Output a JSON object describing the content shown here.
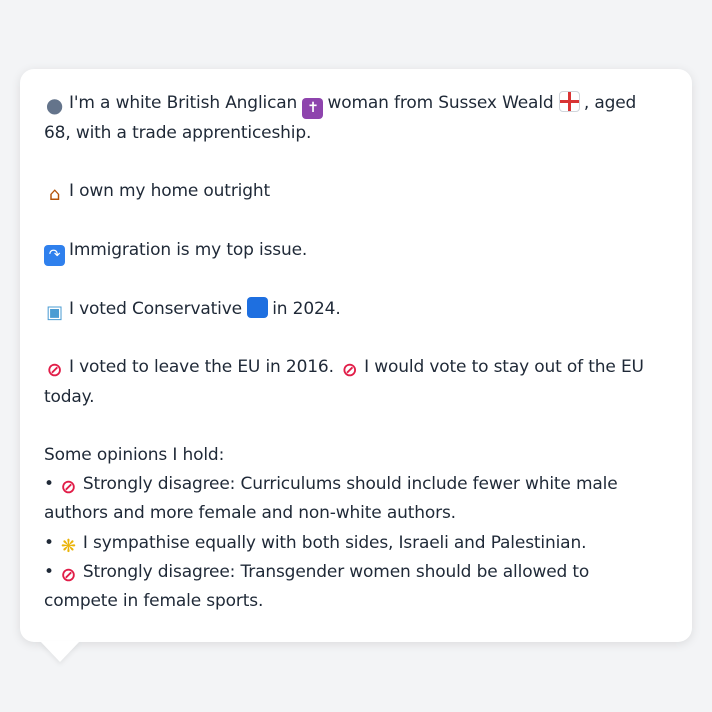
{
  "message": {
    "intro": {
      "icon_person": "person-silhouette-icon",
      "text_a": "I'm a white British Anglican",
      "icon_cross": "latin-cross-icon",
      "text_b": "woman from Sussex Weald",
      "icon_flag": "england-flag-icon",
      "text_c": ", aged 68, with a trade apprenticeship."
    },
    "home": {
      "icon": "house-icon",
      "text": "I own my home outright"
    },
    "issue": {
      "icon": "passport-control-icon",
      "text": "Immigration is my top issue."
    },
    "vote": {
      "icon": "ballot-box-icon",
      "text_a": "I voted Conservative",
      "icon_party": "blue-square-icon",
      "text_b": "in 2024."
    },
    "eu": {
      "icon_a": "prohibited-icon",
      "text_a": "I voted to leave the EU in 2016.",
      "icon_b": "prohibited-icon",
      "text_b": "I would vote to stay out of the EU today."
    },
    "opinions": {
      "heading": "Some opinions I hold:",
      "bullet": "•",
      "items": [
        {
          "icon": "prohibited-icon",
          "text": "Strongly disagree: Curriculums should include fewer white male authors and more female and non-white authors."
        },
        {
          "icon": "handshake-icon",
          "text": "I sympathise equally with both sides, Israeli and Palestinian."
        },
        {
          "icon": "prohibited-icon",
          "text": "Strongly disagree: Transgender women should be allowed to compete in female sports."
        }
      ]
    }
  },
  "colors": {
    "background": "#f3f4f6",
    "bubble": "#ffffff",
    "text": "#1f2937"
  }
}
